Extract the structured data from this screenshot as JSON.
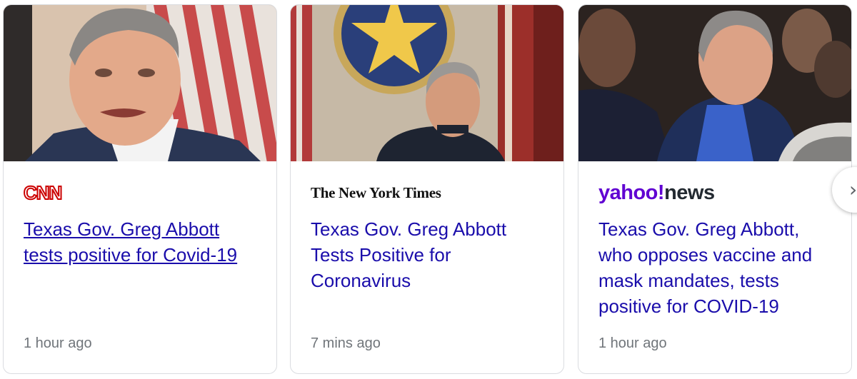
{
  "cards": [
    {
      "source": "CNN",
      "headline": "Texas Gov. Greg Abbott tests positive for Covid-19",
      "time": "1 hour ago"
    },
    {
      "source": "The New York Times",
      "headline": "Texas Gov. Greg Abbott Tests Positive for Coronavirus",
      "time": "7 mins ago"
    },
    {
      "source_part1": "yahoo!",
      "source_part2": "news",
      "headline": "Texas Gov. Greg Abbott, who opposes vaccine and mask mandates, tests positive for COVID-19",
      "time": "1 hour ago"
    }
  ],
  "next_button_icon": "chevron-right-icon",
  "colors": {
    "headline": "#1a0dab",
    "meta": "#70757a",
    "cnn_red": "#cc0000",
    "yahoo_purple": "#6001d2"
  }
}
